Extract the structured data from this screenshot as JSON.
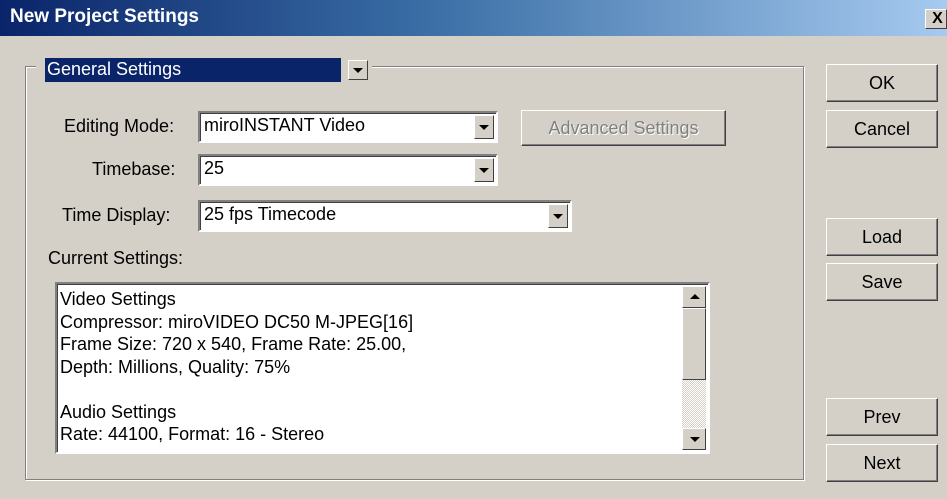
{
  "window": {
    "title": "New Project Settings",
    "close_glyph": "X"
  },
  "settings_category": {
    "value": "General Settings"
  },
  "editing_mode": {
    "label": "Editing Mode:",
    "value": "miroINSTANT Video"
  },
  "timebase": {
    "label": "Timebase:",
    "value": "25"
  },
  "time_display": {
    "label": "Time Display:",
    "value": "25 fps Timecode"
  },
  "advanced_settings": {
    "label": "Advanced Settings",
    "enabled": false
  },
  "current_settings": {
    "label": "Current Settings:",
    "lines": [
      "Video Settings",
      "Compressor: miroVIDEO DC50 M-JPEG[16]",
      "Frame Size: 720 x 540, Frame Rate: 25.00,",
      "Depth: Millions, Quality: 75%",
      "",
      "Audio Settings",
      "Rate: 44100, Format: 16 - Stereo"
    ]
  },
  "buttons": {
    "ok": "OK",
    "cancel": "Cancel",
    "load": "Load",
    "save": "Save",
    "prev": "Prev",
    "next": "Next"
  },
  "colors": {
    "title_bar": "#0a246a",
    "face": "#d4d0c8",
    "selection": "#0a246a"
  }
}
